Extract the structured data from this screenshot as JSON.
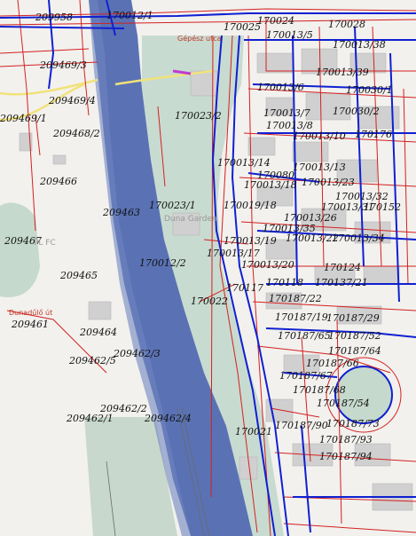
{
  "map": {
    "colors": {
      "background": "#f2f1ee",
      "river": "#5a72b4",
      "park": "#c8dbd0",
      "green_area": "#c8d8cc",
      "buildings": "#cfcfcf",
      "parcel_lines": "#d42020",
      "utility_lines": "#1020d0",
      "road_yellow": "#f1e27a"
    },
    "parcel_labels": [
      {
        "id": "l1",
        "text": "209958"
      },
      {
        "id": "l2",
        "text": "170012/1"
      },
      {
        "id": "l3",
        "text": "170024"
      },
      {
        "id": "l4",
        "text": "170028"
      },
      {
        "id": "l5",
        "text": "170025"
      },
      {
        "id": "l6",
        "text": "170013/5"
      },
      {
        "id": "l7",
        "text": "170013/38"
      },
      {
        "id": "l8",
        "text": "209469/3"
      },
      {
        "id": "l9",
        "text": "170013/39"
      },
      {
        "id": "l10",
        "text": "170013/6"
      },
      {
        "id": "l11",
        "text": "170030/1"
      },
      {
        "id": "l12",
        "text": "209469/4"
      },
      {
        "id": "l13",
        "text": "170023/2"
      },
      {
        "id": "l14",
        "text": "170013/7"
      },
      {
        "id": "l15",
        "text": "170030/2"
      },
      {
        "id": "l16",
        "text": "209469/1"
      },
      {
        "id": "l17",
        "text": "170013/8"
      },
      {
        "id": "l18",
        "text": "209468/2"
      },
      {
        "id": "l19",
        "text": "170013/10"
      },
      {
        "id": "l20",
        "text": "170176"
      },
      {
        "id": "l21",
        "text": "170013/14"
      },
      {
        "id": "l22",
        "text": "170013/13"
      },
      {
        "id": "l23",
        "text": "209466"
      },
      {
        "id": "l24",
        "text": "170080"
      },
      {
        "id": "l25",
        "text": "170013/18"
      },
      {
        "id": "l26",
        "text": "170013/23"
      },
      {
        "id": "l27",
        "text": "170013/32"
      },
      {
        "id": "l28",
        "text": "170023/1"
      },
      {
        "id": "l29",
        "text": "170019/18"
      },
      {
        "id": "l30",
        "text": "170013/31"
      },
      {
        "id": "l31",
        "text": "170152"
      },
      {
        "id": "l32",
        "text": "209463"
      },
      {
        "id": "l33",
        "text": "170013/26"
      },
      {
        "id": "l34",
        "text": "170013/35"
      },
      {
        "id": "l35",
        "text": "209467"
      },
      {
        "id": "l36",
        "text": "170013/19"
      },
      {
        "id": "l37",
        "text": "170013/22"
      },
      {
        "id": "l38",
        "text": "170013/34"
      },
      {
        "id": "l39",
        "text": "170013/17"
      },
      {
        "id": "l40",
        "text": "170012/2"
      },
      {
        "id": "l41",
        "text": "170013/20"
      },
      {
        "id": "l42",
        "text": "170124"
      },
      {
        "id": "l43",
        "text": "209465"
      },
      {
        "id": "l44",
        "text": "170117"
      },
      {
        "id": "l45",
        "text": "170118"
      },
      {
        "id": "l46",
        "text": "170137/21"
      },
      {
        "id": "l47",
        "text": "170022"
      },
      {
        "id": "l48",
        "text": "170187/22"
      },
      {
        "id": "l49",
        "text": "209461"
      },
      {
        "id": "l50",
        "text": "170187/19"
      },
      {
        "id": "l51",
        "text": "170187/29"
      },
      {
        "id": "l52",
        "text": "209464"
      },
      {
        "id": "l53",
        "text": "170187/65"
      },
      {
        "id": "l54",
        "text": "170187/52"
      },
      {
        "id": "l55",
        "text": "209462/3"
      },
      {
        "id": "l56",
        "text": "209462/5"
      },
      {
        "id": "l57",
        "text": "170187/64"
      },
      {
        "id": "l58",
        "text": "170187/66"
      },
      {
        "id": "l59",
        "text": "170187/67"
      },
      {
        "id": "l60",
        "text": "170187/68"
      },
      {
        "id": "l61",
        "text": "170187/54"
      },
      {
        "id": "l62",
        "text": "209462/2"
      },
      {
        "id": "l63",
        "text": "209462/1"
      },
      {
        "id": "l64",
        "text": "209462/4"
      },
      {
        "id": "l65",
        "text": "170021"
      },
      {
        "id": "l66",
        "text": "170187/90"
      },
      {
        "id": "l67",
        "text": "170187/73"
      },
      {
        "id": "l68",
        "text": "170187/93"
      },
      {
        "id": "l69",
        "text": "170187/94"
      }
    ],
    "place_labels": [
      {
        "id": "p1",
        "text": "Duna Garden"
      },
      {
        "id": "p2",
        "text": "PL FC"
      },
      {
        "id": "p3",
        "text": "Dunadűlő út"
      },
      {
        "id": "p4",
        "text": "Gépész utca"
      }
    ]
  }
}
